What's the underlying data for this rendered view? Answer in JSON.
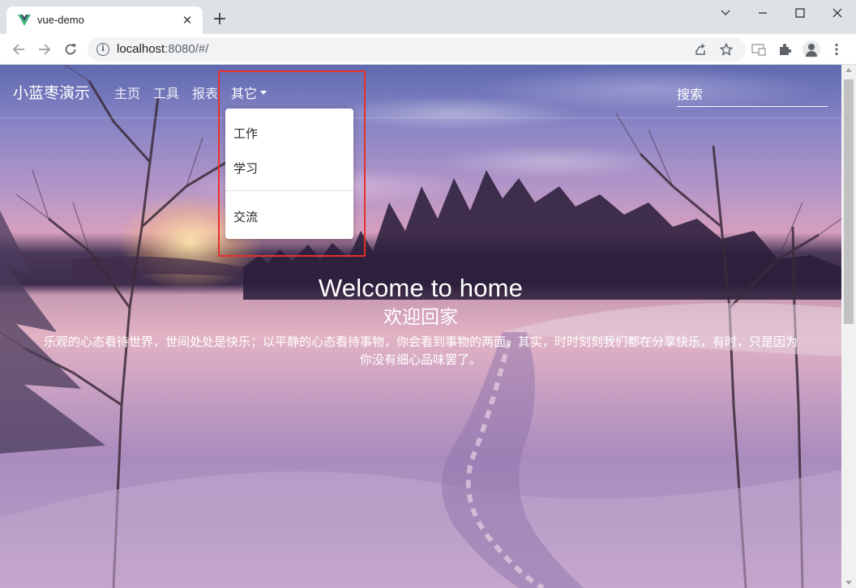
{
  "browser": {
    "tab_title": "vue-demo",
    "new_tab_symbol": "+",
    "url_host": "localhost",
    "url_rest": ":8080/#/",
    "icons": [
      "vue-favicon",
      "close-icon",
      "chevron-down-icon",
      "minimize-icon",
      "maximize-icon",
      "close-window-icon",
      "back-icon",
      "forward-icon",
      "reload-icon",
      "info-icon",
      "share-icon",
      "star-icon",
      "cast-icon",
      "puzzle-icon",
      "profile-icon",
      "kebab-menu-icon"
    ]
  },
  "navbar": {
    "brand": "小蓝枣演示",
    "links": [
      "主页",
      "工具",
      "报表",
      "其它"
    ],
    "search_placeholder": "搜索"
  },
  "dropdown": {
    "items": [
      "工作",
      "学习",
      "交流"
    ],
    "highlight_color": "#e8302b"
  },
  "hero": {
    "title": "Welcome to home",
    "subtitle": "欢迎回家",
    "text": "乐观的心态看待世界，世间处处是快乐；以平静的心态看待事物，你会看到事物的两面，其实，时时刻刻我们都在分享快乐，有时，只是因为你没有细心品味罢了。"
  }
}
